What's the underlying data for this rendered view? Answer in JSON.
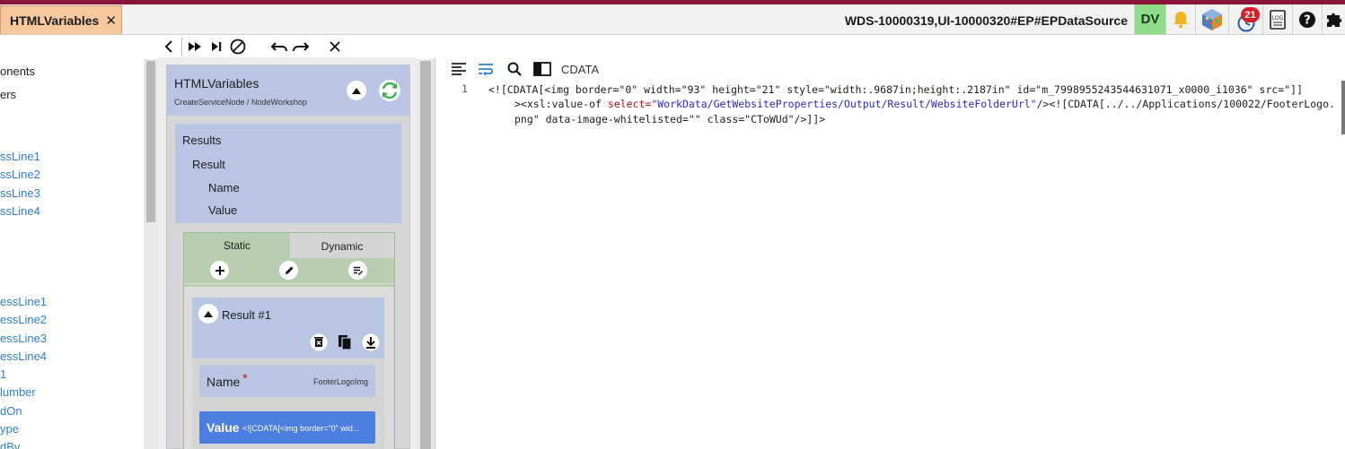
{
  "colors": {
    "accent_top": "#8a1538",
    "tab_active_bg": "#f7c99c",
    "dv_badge_bg": "#8fdc8a",
    "panel_blue": "#b9c6e3",
    "panel_green": "#b7cfb0",
    "value_field_bg": "#4c7de0",
    "link_blue": "#2f7dd3",
    "notification_red": "#d61f26"
  },
  "tabs": [
    {
      "label": "HTMLVariables",
      "close_icon": "close-icon"
    }
  ],
  "header": {
    "context_id": "WDS-10000319,UI-10000320#EP#EPDataSource",
    "dv_label": "DV",
    "notification_count": "21",
    "icons": [
      "bell-icon",
      "cube-icon",
      "clock-notification-icon",
      "log-icon",
      "help-icon",
      "puzzle-icon"
    ]
  },
  "toolbar": {
    "icons": [
      "back-icon",
      "fast-forward-icon",
      "skip-end-icon",
      "cancel-circle-icon",
      "undo-icon",
      "redo-icon",
      "close-icon"
    ]
  },
  "left_tree": {
    "items": [
      {
        "label": "onents",
        "style": "dark"
      },
      {
        "label": "ers",
        "style": "dark"
      },
      {
        "label": "ssLine1",
        "style": "link"
      },
      {
        "label": "ssLine2",
        "style": "link"
      },
      {
        "label": "ssLine3",
        "style": "link"
      },
      {
        "label": "ssLine4",
        "style": "link"
      },
      {
        "label": "essLine1",
        "style": "link"
      },
      {
        "label": "essLine2",
        "style": "link"
      },
      {
        "label": "essLine3",
        "style": "link"
      },
      {
        "label": "essLine4",
        "style": "link"
      },
      {
        "label": "1",
        "style": "link"
      },
      {
        "label": "lumber",
        "style": "link"
      },
      {
        "label": "dOn",
        "style": "link"
      },
      {
        "label": "ype",
        "style": "link"
      },
      {
        "label": "dBy",
        "style": "link"
      }
    ]
  },
  "workflow": {
    "title": "HTMLVariables",
    "subtitle": "CreateServiceNode / NodeWorkshop",
    "results": {
      "title": "Results",
      "result": "Result",
      "name": "Name",
      "value": "Value"
    },
    "tabs": {
      "static": "Static",
      "dynamic": "Dynamic"
    },
    "result_item": {
      "title": "Result #1",
      "name_label": "Name",
      "required_mark": "*",
      "name_value": "FooterLogoImg",
      "value_label": "Value",
      "value_preview": "<![CDATA[<img border=\"0\" wid..."
    }
  },
  "editor": {
    "mode_label": "CDATA",
    "line_number": "1",
    "line1": {
      "p1": "<![CDATA[<img border=\"0\" width=\"93\" height=\"21\" style=\"width:.9687in;height:.2187in\" id=\"m_7998955243544631071_x0000_i1036\" src=\"]]"
    },
    "line2": {
      "p1": "><xsl:value-of ",
      "p2": "select=",
      "p3": "\"WorkData/GetWebsiteProperties/Output/Result/WebsiteFolderUrl\"",
      "p4": "/><![CDATA[../../Applications/100022/FooterLogo."
    },
    "line3": {
      "p1": "png\" data-image-whitelisted=\"\" class=\"CToWUd\"/>]]>"
    }
  }
}
